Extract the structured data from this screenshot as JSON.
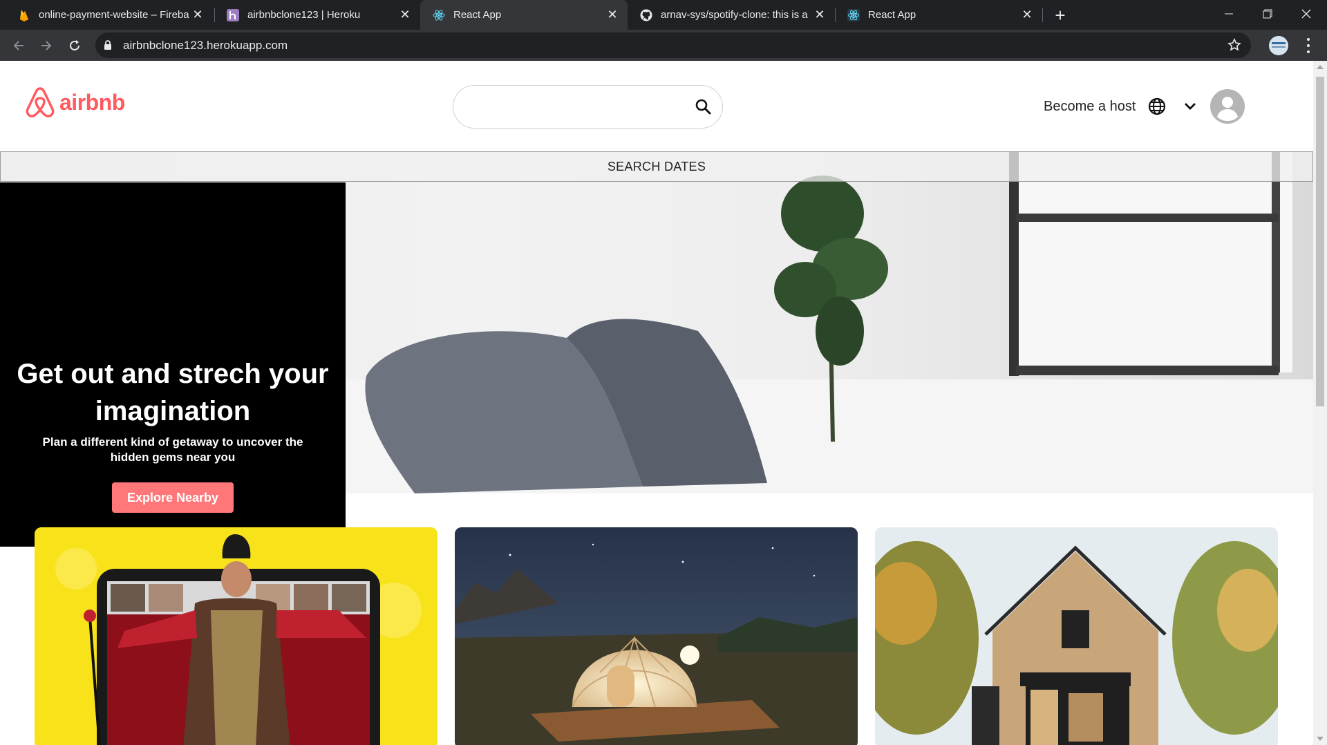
{
  "browser": {
    "tabs": [
      {
        "title": "online-payment-website – Fireba",
        "icon": "firebase-icon",
        "active": false
      },
      {
        "title": "airbnbclone123 | Heroku",
        "icon": "heroku-icon",
        "active": false
      },
      {
        "title": "React App",
        "icon": "react-icon",
        "active": true
      },
      {
        "title": "arnav-sys/spotify-clone: this is a",
        "icon": "github-icon",
        "active": false
      },
      {
        "title": "React App",
        "icon": "react-icon",
        "active": false
      }
    ],
    "url": "airbnbclone123.herokuapp.com"
  },
  "header": {
    "logo_text": "airbnb",
    "search_placeholder": "",
    "become_host": "Become a host"
  },
  "hero": {
    "search_dates": "SEARCH DATES",
    "title": "Get out and strech your imagination",
    "subtitle": "Plan a different kind of getaway to uncover the hidden gems near you",
    "cta": "Explore Nearby"
  },
  "cards": [
    {
      "image": "online-experiences-image"
    },
    {
      "image": "glamping-dome-image"
    },
    {
      "image": "wooden-cabin-image"
    }
  ],
  "colors": {
    "brand": "#ff5a5f",
    "cta": "#ff7779",
    "tab_bg": "#202124",
    "toolbar_bg": "#35363a"
  }
}
